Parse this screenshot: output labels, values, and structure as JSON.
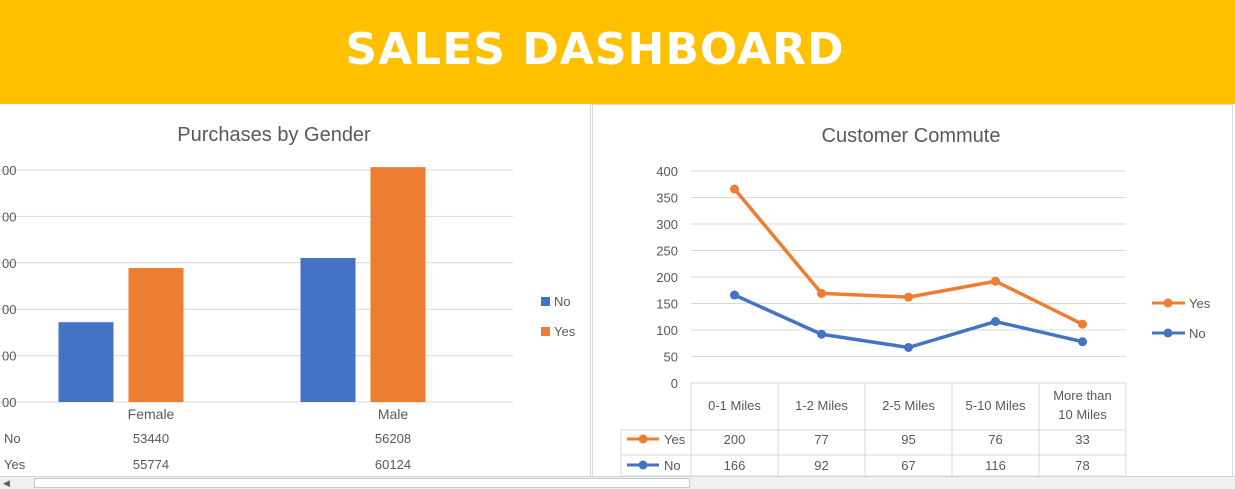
{
  "header": {
    "title": "SALES DASHBOARD"
  },
  "colors": {
    "banner": "#ffc000",
    "series_no": "#4472c4",
    "series_yes": "#ed7d31",
    "grid": "#d9d9d9",
    "text": "#595959"
  },
  "chart_data": [
    {
      "type": "bar",
      "title": "Purchases by Gender",
      "categories": [
        "Female",
        "Male"
      ],
      "series": [
        {
          "name": "No",
          "values": [
            53440,
            56208
          ]
        },
        {
          "name": "Yes",
          "values": [
            55774,
            60124
          ]
        }
      ],
      "ylim": [
        50000,
        60000
      ],
      "yticks": [
        50000,
        52000,
        54000,
        56000,
        58000,
        60000
      ],
      "ytick_labels_visible": [
        "00",
        "00",
        "00",
        "00",
        "00",
        "00"
      ],
      "grid": true,
      "legend": "right",
      "data_table": true,
      "table_rows": [
        {
          "name": "No",
          "values": [
            "53440",
            "56208"
          ]
        },
        {
          "name": "Yes",
          "values": [
            "55774",
            "60124"
          ]
        }
      ]
    },
    {
      "type": "line",
      "title": "Customer Commute",
      "categories": [
        "0-1 Miles",
        "1-2 Miles",
        "2-5 Miles",
        "5-10 Miles",
        "More than 10 Miles"
      ],
      "series": [
        {
          "name": "Yes",
          "values": [
            366,
            169,
            162,
            192,
            111
          ]
        },
        {
          "name": "No",
          "values": [
            166,
            92,
            67,
            116,
            78
          ]
        }
      ],
      "ylim": [
        0,
        400
      ],
      "yticks": [
        "0",
        "50",
        "100",
        "150",
        "200",
        "250",
        "300",
        "350",
        "400"
      ],
      "grid": true,
      "legend": "right",
      "data_table": true,
      "table_rows": [
        {
          "name": "Yes",
          "values": [
            "200",
            "77",
            "95",
            "76",
            "33"
          ]
        },
        {
          "name": "No",
          "values": [
            "166",
            "92",
            "67",
            "116",
            "78"
          ]
        }
      ]
    }
  ]
}
